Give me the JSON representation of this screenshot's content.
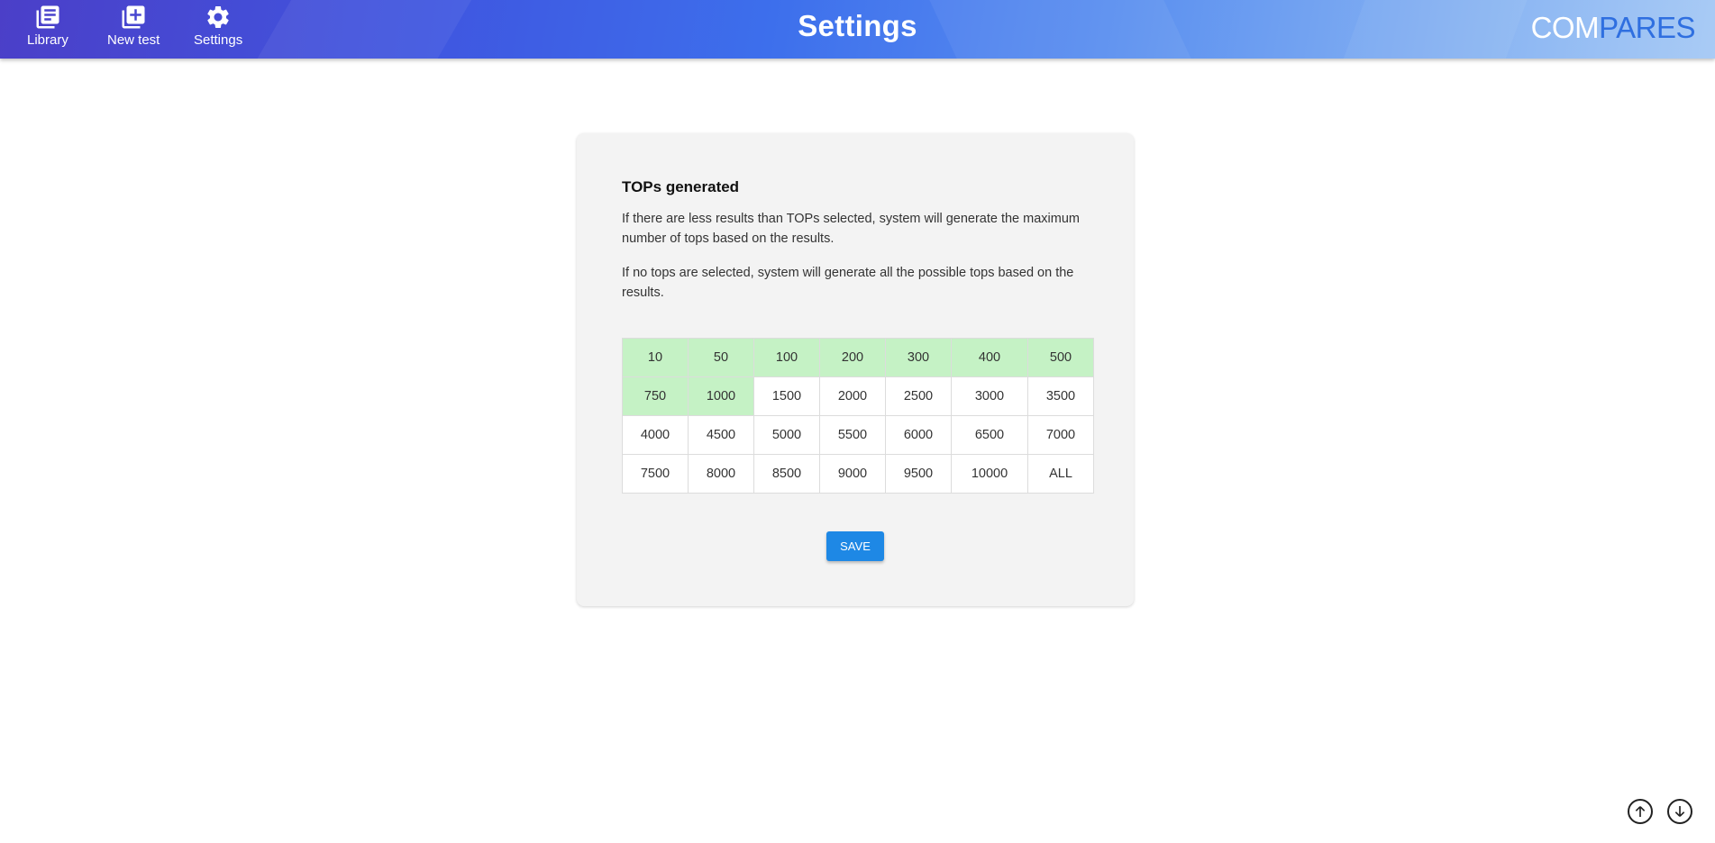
{
  "nav": {
    "items": [
      {
        "label": "Library",
        "icon": "library-icon"
      },
      {
        "label": "New test",
        "icon": "add-box-icon"
      },
      {
        "label": "Settings",
        "icon": "gear-icon"
      }
    ]
  },
  "header": {
    "title": "Settings",
    "logo_part1": "COM",
    "logo_part2": "PARES"
  },
  "card": {
    "title": "TOPs generated",
    "paragraph1": "If there are less results than TOPs selected, system will generate the maximum number of tops based on the results.",
    "paragraph2": "If no tops are selected, system will generate all the possible tops based on the results.",
    "grid": [
      [
        {
          "v": "10",
          "sel": true
        },
        {
          "v": "50",
          "sel": true
        },
        {
          "v": "100",
          "sel": true
        },
        {
          "v": "200",
          "sel": true
        },
        {
          "v": "300",
          "sel": true
        },
        {
          "v": "400",
          "sel": true
        },
        {
          "v": "500",
          "sel": true
        }
      ],
      [
        {
          "v": "750",
          "sel": true
        },
        {
          "v": "1000",
          "sel": true
        },
        {
          "v": "1500",
          "sel": false
        },
        {
          "v": "2000",
          "sel": false
        },
        {
          "v": "2500",
          "sel": false
        },
        {
          "v": "3000",
          "sel": false
        },
        {
          "v": "3500",
          "sel": false
        }
      ],
      [
        {
          "v": "4000",
          "sel": false
        },
        {
          "v": "4500",
          "sel": false
        },
        {
          "v": "5000",
          "sel": false
        },
        {
          "v": "5500",
          "sel": false
        },
        {
          "v": "6000",
          "sel": false
        },
        {
          "v": "6500",
          "sel": false
        },
        {
          "v": "7000",
          "sel": false
        }
      ],
      [
        {
          "v": "7500",
          "sel": false
        },
        {
          "v": "8000",
          "sel": false
        },
        {
          "v": "8500",
          "sel": false
        },
        {
          "v": "9000",
          "sel": false
        },
        {
          "v": "9500",
          "sel": false
        },
        {
          "v": "10000",
          "sel": false
        },
        {
          "v": "ALL",
          "sel": false
        }
      ]
    ],
    "save_label": "SAVE"
  },
  "colors": {
    "selected_cell": "#c5f2c5",
    "save_button": "#1e88e5",
    "logo_accent": "#2f6fe0"
  },
  "scroll": {
    "up_icon": "arrow-up-circle-icon",
    "down_icon": "arrow-down-circle-icon"
  }
}
